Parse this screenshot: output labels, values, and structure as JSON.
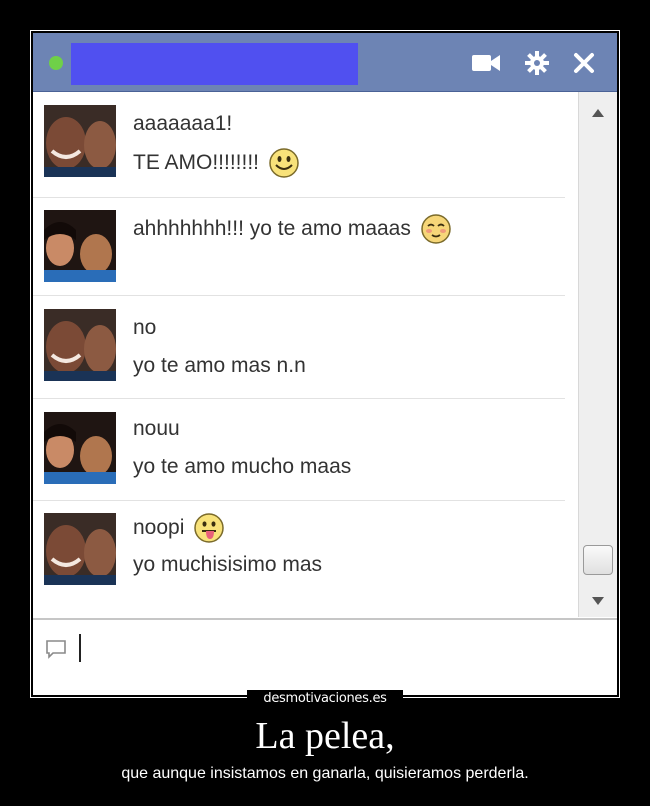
{
  "chat": {
    "status_color": "#6fd048",
    "titlebar_color": "#6d84b4",
    "redaction_color": "#5050f0",
    "header_icons": [
      "video-camera-icon",
      "settings-gear-icon",
      "close-icon"
    ],
    "messages": [
      {
        "sender": "user-a",
        "lines": [
          "aaaaaaa1!",
          "TE AMO!!!!!!!!"
        ],
        "emoji_after_line": 1,
        "emoji": "smile-emoji"
      },
      {
        "sender": "user-b",
        "lines": [
          "ahhhhhhh!!! yo te amo maaas"
        ],
        "emoji_after_line": 0,
        "emoji": "blush-emoji"
      },
      {
        "sender": "user-a",
        "lines": [
          "no",
          "yo te amo mas n.n"
        ]
      },
      {
        "sender": "user-b",
        "lines": [
          "nouu",
          "yo te amo mucho maas"
        ]
      },
      {
        "sender": "user-a",
        "lines": [
          "noopi",
          "yo muchisisimo mas"
        ],
        "emoji_after_line": 0,
        "emoji": "tongue-emoji"
      }
    ],
    "input": {
      "value": "",
      "placeholder": ""
    }
  },
  "poster": {
    "watermark": "desmotivaciones.es",
    "title": "La pelea,",
    "subtitle": "que aunque insistamos en ganarla, quisieramos perderla."
  }
}
